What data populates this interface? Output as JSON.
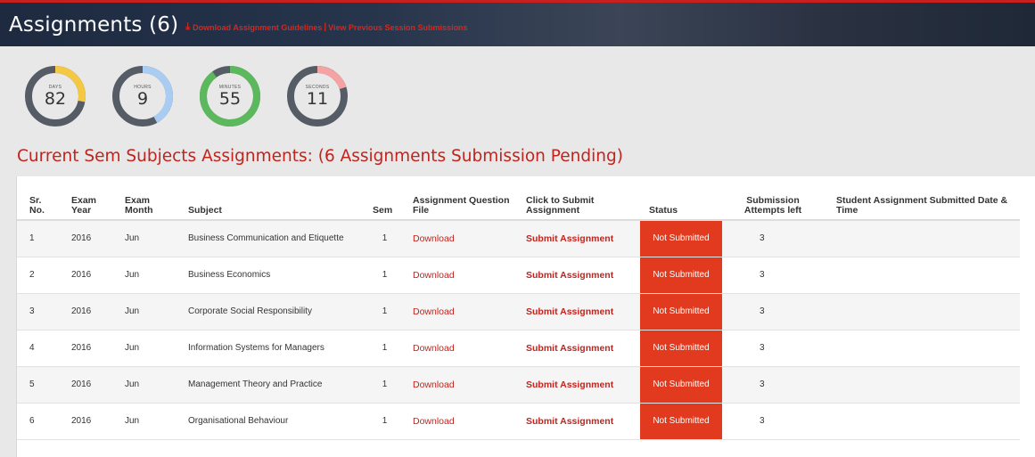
{
  "header": {
    "title": "Assignments (6)",
    "download_guidelines": "Download Assignment Guidelines",
    "separator": "|",
    "previous_submissions": "View Previous Session Submissions"
  },
  "timers": [
    {
      "label": "DAYS",
      "value": "82",
      "color": "#f4c842",
      "fraction": 0.28
    },
    {
      "label": "HOURS",
      "value": "9",
      "color": "#a9cdf2",
      "fraction": 0.42
    },
    {
      "label": "MINUTES",
      "value": "55",
      "color": "#5cb85c",
      "fraction": 0.9
    },
    {
      "label": "SECONDS",
      "value": "11",
      "color": "#f4a2a2",
      "fraction": 0.2
    }
  ],
  "timer_track_color": "#555c66",
  "section_title": "Current Sem Subjects Assignments: (6 Assignments Submission Pending)",
  "table": {
    "headers": [
      "Sr. No.",
      "Exam Year",
      "Exam Month",
      "Subject",
      "Sem",
      "Assignment Question File",
      "Click to Submit Assignment",
      "Status",
      "Submission Attempts left",
      "Student Assignment Submitted Date & Time"
    ],
    "rows": [
      {
        "sr": "1",
        "year": "2016",
        "month": "Jun",
        "subject": "Business Communication and Etiquette",
        "sem": "1",
        "download": "Download",
        "submit": "Submit Assignment",
        "status": "Not Submitted",
        "attempts": "3",
        "submitted_at": ""
      },
      {
        "sr": "2",
        "year": "2016",
        "month": "Jun",
        "subject": "Business Economics",
        "sem": "1",
        "download": "Download",
        "submit": "Submit Assignment",
        "status": "Not Submitted",
        "attempts": "3",
        "submitted_at": ""
      },
      {
        "sr": "3",
        "year": "2016",
        "month": "Jun",
        "subject": "Corporate Social Responsibility",
        "sem": "1",
        "download": "Download",
        "submit": "Submit Assignment",
        "status": "Not Submitted",
        "attempts": "3",
        "submitted_at": ""
      },
      {
        "sr": "4",
        "year": "2016",
        "month": "Jun",
        "subject": "Information Systems for Managers",
        "sem": "1",
        "download": "Download",
        "submit": "Submit Assignment",
        "status": "Not Submitted",
        "attempts": "3",
        "submitted_at": ""
      },
      {
        "sr": "5",
        "year": "2016",
        "month": "Jun",
        "subject": "Management Theory and Practice",
        "sem": "1",
        "download": "Download",
        "submit": "Submit Assignment",
        "status": "Not Submitted",
        "attempts": "3",
        "submitted_at": ""
      },
      {
        "sr": "6",
        "year": "2016",
        "month": "Jun",
        "subject": "Organisational Behaviour",
        "sem": "1",
        "download": "Download",
        "submit": "Submit Assignment",
        "status": "Not Submitted",
        "attempts": "3",
        "submitted_at": ""
      }
    ]
  }
}
